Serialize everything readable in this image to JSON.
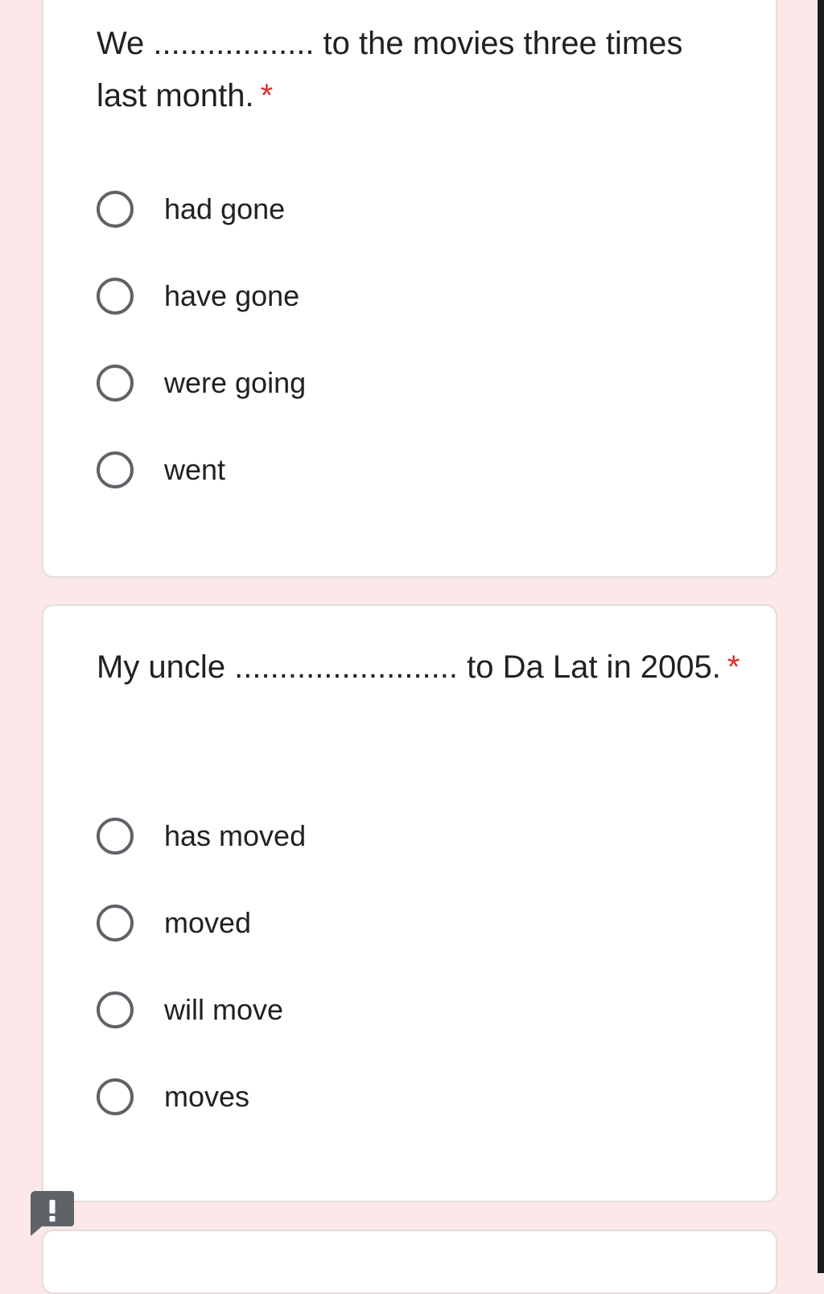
{
  "questions": [
    {
      "text": "We .................. to the movies three times last month.",
      "required_marker": "*",
      "options": [
        "had gone",
        "have gone",
        "were going",
        "went"
      ]
    },
    {
      "text": "My uncle ......................... to Da Lat in 2005.",
      "required_marker": "*",
      "options": [
        "has moved",
        "moved",
        "will move",
        "moves"
      ]
    }
  ],
  "feedback_button": {
    "icon": "exclamation-icon"
  },
  "colors": {
    "page_background": "#fce8e8",
    "card_background": "#ffffff",
    "required_star": "#d93025",
    "radio_border": "#5f6368",
    "feedback_button": "#5f6368"
  }
}
